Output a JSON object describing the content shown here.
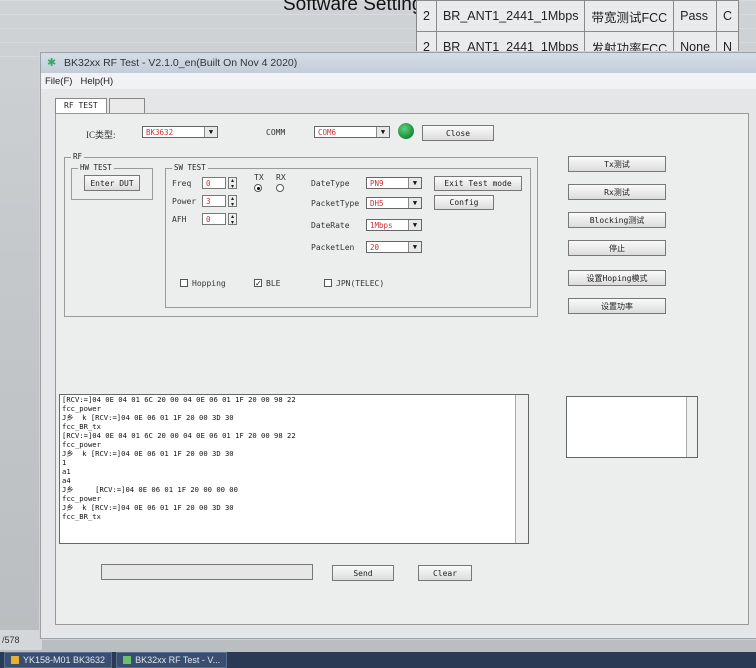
{
  "background": {
    "title": "Software Setting",
    "rows": [
      [
        "2",
        "BR_ANT1_2441_1Mbps",
        "带宽测试FCC",
        "Pass",
        "C"
      ],
      [
        "2",
        "BR_ANT1_2441_1Mbps",
        "发射功率FCC",
        "None",
        "N"
      ]
    ],
    "page_indicator": "/578"
  },
  "window": {
    "title": "BK32xx RF Test - V2.1.0_en(Built On Nov  4 2020)",
    "menu": [
      "File(F)",
      "Help(H)"
    ],
    "tabs": [
      "RF TEST",
      ""
    ]
  },
  "top": {
    "ic_label": "IC类型:",
    "ic_value": "BK3632",
    "comm_label": "COMM",
    "comm_value": "COM6",
    "close_label": "Close",
    "status_color": "#1a8a3a"
  },
  "rf_group": {
    "label": "RF",
    "hw_test": {
      "label": "HW TEST",
      "enter_dut": "Enter DUT"
    },
    "sw_test": {
      "label": "SW TEST",
      "freq_label": "Freq",
      "freq_value": "0",
      "power_label": "Power",
      "power_value": "3",
      "afh_label": "AFH",
      "afh_value": "0",
      "tx_label": "TX",
      "rx_label": "RX",
      "datetype_label": "DateType",
      "datetype_value": "PN9",
      "packettype_label": "PacketType",
      "packettype_value": "DH5",
      "daterate_label": "DateRate",
      "daterate_value": "1Mbps",
      "packetlen_label": "PacketLen",
      "packetlen_value": "20",
      "exit_test": "Exit Test mode",
      "config": "Config",
      "hopping": "Hopping",
      "ble": "BLE",
      "jpn": "JPN(TELEC)"
    }
  },
  "side_buttons": [
    "Tx测试",
    "Rx测试",
    "Blocking测试",
    "停止",
    "设置Hoping模式",
    "设置功率"
  ],
  "log_lines": [
    "[RCV:=]04 0E 04 01 6C 20 00 04 0E 06 01 1F 20 00 98 22",
    "fcc_power",
    "J乡  k [RCV:=]04 0E 06 01 1F 20 00 3D 30",
    "fcc_BR_tx",
    "[RCV:=]04 0E 04 01 6C 20 00 04 0E 06 01 1F 20 00 98 22",
    "fcc_power",
    "J乡  k [RCV:=]04 0E 06 01 1F 20 00 3D 30",
    "1",
    "a1",
    "a4",
    "J乡     [RCV:=]04 0E 06 01 1F 20 00 00 00",
    "fcc_power",
    "J乡  k [RCV:=]04 0E 06 01 1F 20 00 3D 30",
    "fcc_BR_tx"
  ],
  "bottom": {
    "send": "Send",
    "clear": "Clear"
  },
  "taskbar": [
    "YK158-M01 BK3632",
    "BK32xx RF Test - V..."
  ]
}
